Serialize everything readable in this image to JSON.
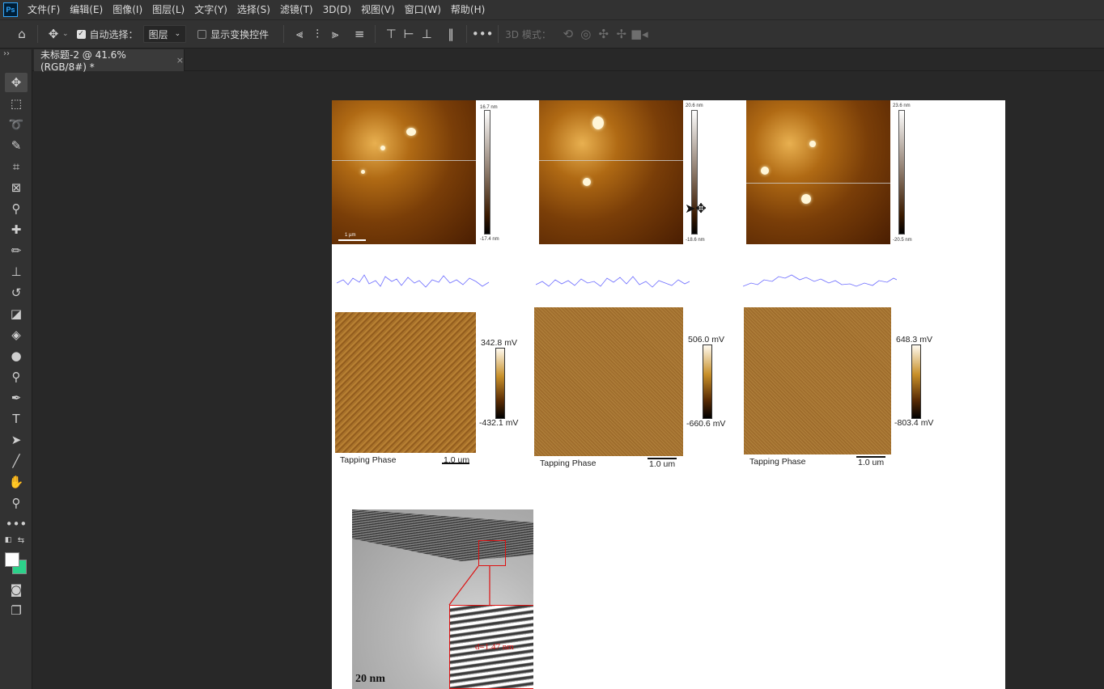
{
  "app": {
    "logo": "Ps"
  },
  "menu": [
    "文件(F)",
    "编辑(E)",
    "图像(I)",
    "图层(L)",
    "文字(Y)",
    "选择(S)",
    "滤镜(T)",
    "3D(D)",
    "视图(V)",
    "窗口(W)",
    "帮助(H)"
  ],
  "options": {
    "auto_select_label": "自动选择：",
    "auto_select_checked": true,
    "layer_dropdown": "图层",
    "show_transform_label": "显示变换控件",
    "show_transform_checked": false,
    "mode_3d_label": "3D 模式："
  },
  "tab": {
    "title": "未标题-2 @ 41.6%(RGB/8#) *",
    "close": "×"
  },
  "tools": [
    "move-icon",
    "marquee-icon",
    "lasso-icon",
    "quick-select-icon",
    "crop-icon",
    "frame-icon",
    "eyedropper-icon",
    "healing-icon",
    "brush-icon",
    "stamp-icon",
    "history-brush-icon",
    "eraser-icon",
    "paint-bucket-icon",
    "blur-icon",
    "dodge-icon",
    "pen-icon",
    "type-icon",
    "path-select-icon",
    "line-icon",
    "hand-icon",
    "zoom-icon",
    "more-icon"
  ],
  "colors": {
    "foreground": "#ffffff",
    "background": "#2cd18a",
    "accent": "#31a8ff"
  },
  "canvas": {
    "afm_top": [
      {
        "scale_top": "16.7 nm",
        "scale_bottom": "-17.4 nm",
        "scalebar": "1 µm"
      },
      {
        "scale_top": "20.6 nm",
        "scale_bottom": "-18.6 nm"
      },
      {
        "scale_top": "23.6 nm",
        "scale_bottom": "-20.5 nm"
      }
    ],
    "phase": [
      {
        "top": "342.8 mV",
        "bottom": "-432.1 mV",
        "label": "Tapping Phase",
        "scale": "1.0 um"
      },
      {
        "top": "506.0 mV",
        "bottom": "-660.6 mV",
        "label": "Tapping Phase",
        "scale": "1.0 um"
      },
      {
        "top": "648.3 mV",
        "bottom": "-803.4 mV",
        "label": "Tapping Phase",
        "scale": "1.0 um"
      }
    ],
    "tem": {
      "scale": "20 nm",
      "annotation": "d=1.47 nm"
    }
  }
}
